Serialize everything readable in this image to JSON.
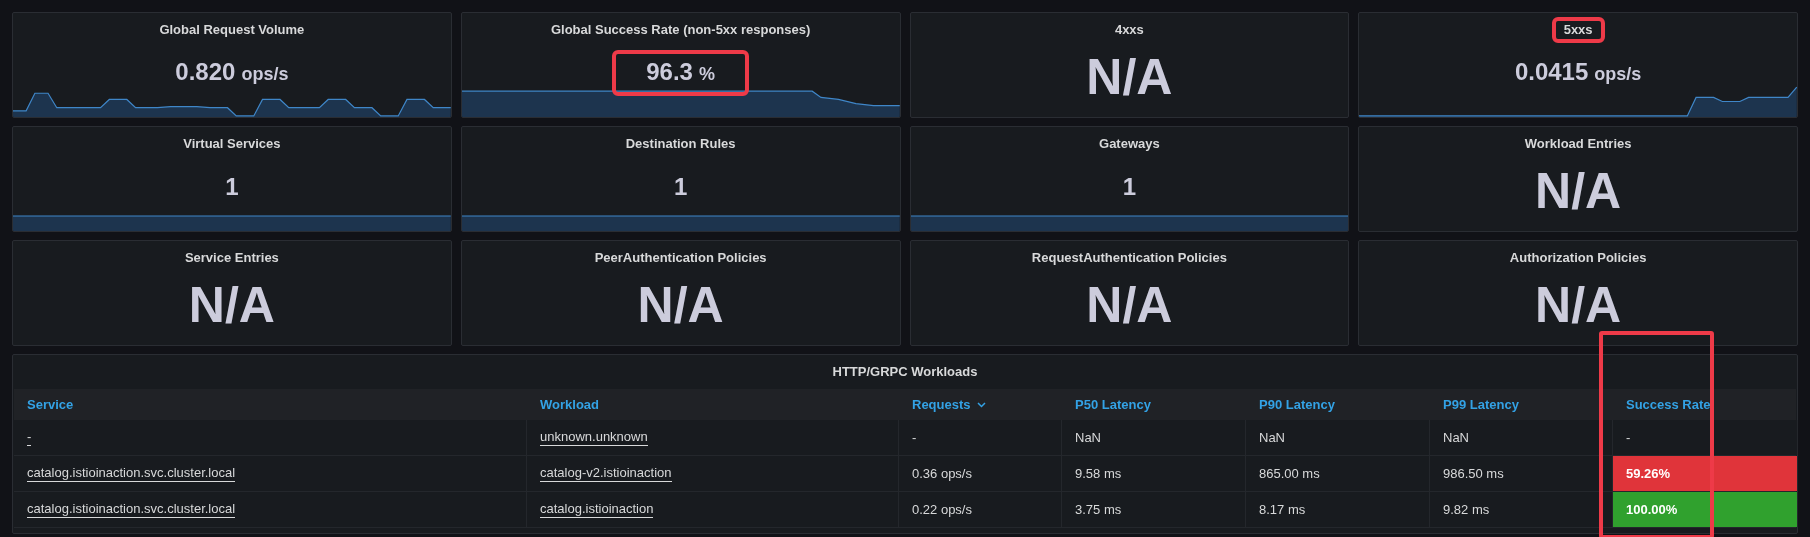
{
  "panels": [
    {
      "title": "Global Request Volume",
      "value": "0.820",
      "unit": "ops/s",
      "sparkline": {
        "kind": "pulses"
      }
    },
    {
      "title": "Global Success Rate (non-5xx responses)",
      "value": "96.3",
      "unit": "%",
      "sparkline": {
        "kind": "plateau"
      },
      "value_highlighted": true
    },
    {
      "title": "4xxs",
      "value": "N/A"
    },
    {
      "title": "5xxs",
      "value": "0.0415",
      "unit": "ops/s",
      "sparkline": {
        "kind": "rise"
      },
      "title_highlighted": true
    },
    {
      "title": "Virtual Services",
      "value": "1",
      "sparkline": {
        "kind": "flat"
      }
    },
    {
      "title": "Destination Rules",
      "value": "1",
      "sparkline": {
        "kind": "flat"
      }
    },
    {
      "title": "Gateways",
      "value": "1",
      "sparkline": {
        "kind": "flat"
      }
    },
    {
      "title": "Workload Entries",
      "value": "N/A"
    },
    {
      "title": "Service Entries",
      "value": "N/A"
    },
    {
      "title": "PeerAuthentication Policies",
      "value": "N/A"
    },
    {
      "title": "RequestAuthentication Policies",
      "value": "N/A"
    },
    {
      "title": "Authorization Policies",
      "value": "N/A"
    }
  ],
  "table": {
    "title": "HTTP/GRPC Workloads",
    "columns": [
      {
        "label": "Service",
        "sorted": false,
        "highlighted": false
      },
      {
        "label": "Workload",
        "sorted": false,
        "highlighted": false
      },
      {
        "label": "Requests",
        "sorted": true,
        "highlighted": false
      },
      {
        "label": "P50 Latency",
        "sorted": false,
        "highlighted": false
      },
      {
        "label": "P90 Latency",
        "sorted": false,
        "highlighted": false
      },
      {
        "label": "P99 Latency",
        "sorted": false,
        "highlighted": false
      },
      {
        "label": "Success Rate",
        "sorted": false,
        "highlighted": true
      }
    ],
    "rows": [
      {
        "cells": [
          {
            "text": "-",
            "kind": "link"
          },
          {
            "text": "unknown.unknown",
            "kind": "link"
          },
          {
            "text": "-",
            "kind": "text"
          },
          {
            "text": "NaN",
            "kind": "text"
          },
          {
            "text": "NaN",
            "kind": "text"
          },
          {
            "text": "NaN",
            "kind": "text"
          },
          {
            "text": "-",
            "kind": "text"
          }
        ]
      },
      {
        "cells": [
          {
            "text": "catalog.istioinaction.svc.cluster.local",
            "kind": "link"
          },
          {
            "text": "catalog-v2.istioinaction",
            "kind": "link"
          },
          {
            "text": "0.36 ops/s",
            "kind": "text"
          },
          {
            "text": "9.58 ms",
            "kind": "text"
          },
          {
            "text": "865.00 ms",
            "kind": "text"
          },
          {
            "text": "986.50 ms",
            "kind": "text"
          },
          {
            "text": "59.26%",
            "kind": "text",
            "color": "#e0343a"
          }
        ]
      },
      {
        "cells": [
          {
            "text": "catalog.istioinaction.svc.cluster.local",
            "kind": "link"
          },
          {
            "text": "catalog.istioinaction",
            "kind": "link"
          },
          {
            "text": "0.22 ops/s",
            "kind": "text"
          },
          {
            "text": "3.75 ms",
            "kind": "text"
          },
          {
            "text": "8.17 ms",
            "kind": "text"
          },
          {
            "text": "9.82 ms",
            "kind": "text"
          },
          {
            "text": "100.00%",
            "kind": "text",
            "color": "#30a12e"
          }
        ]
      }
    ]
  }
}
